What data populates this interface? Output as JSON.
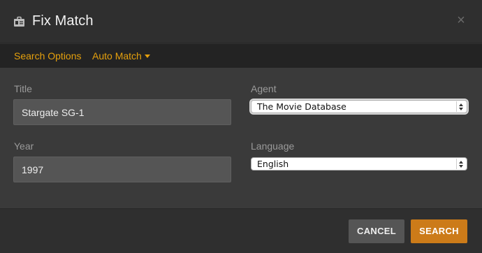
{
  "header": {
    "title": "Fix Match",
    "icon": "id-card-icon",
    "close_label": "×"
  },
  "tabs": [
    {
      "label": "Search Options"
    },
    {
      "label": "Auto Match"
    }
  ],
  "form": {
    "title_label": "Title",
    "title_value": "Stargate SG-1",
    "year_label": "Year",
    "year_value": "1997",
    "agent_label": "Agent",
    "agent_value": "The Movie Database",
    "language_label": "Language",
    "language_value": "English"
  },
  "footer": {
    "cancel_label": "CANCEL",
    "search_label": "SEARCH"
  },
  "colors": {
    "accent": "#e5a00d",
    "search_button": "#cc7b19",
    "cancel_button": "#555555"
  }
}
